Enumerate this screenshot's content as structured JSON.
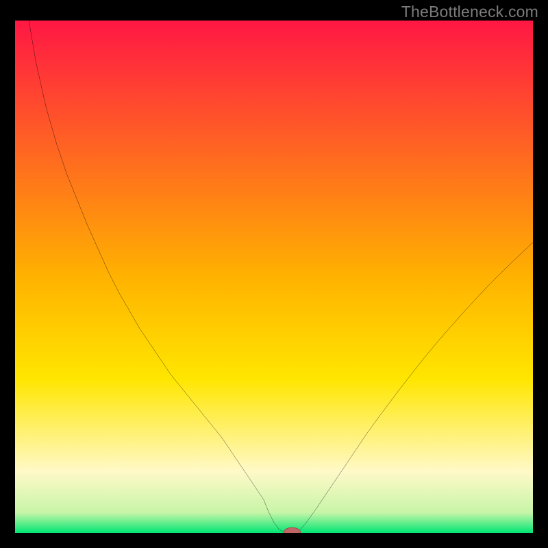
{
  "watermark": "TheBottleneck.com",
  "colors": {
    "frame": "#000000",
    "watermark": "#7c7c7c",
    "curve": "#000000",
    "marker_fill": "#c06666",
    "marker_stroke": "#a04848",
    "gradient_top": "#ff1744",
    "gradient_yellow": "#ffe600",
    "gradient_cream": "#fff9c8",
    "gradient_green": "#00e673"
  },
  "chart_data": {
    "type": "line",
    "title": "",
    "xlabel": "",
    "ylabel": "",
    "xlim": [
      0,
      100
    ],
    "ylim": [
      0,
      100
    ],
    "grid": false,
    "legend": false,
    "x": [
      0,
      2,
      4,
      6,
      8,
      10,
      12,
      14,
      16,
      18,
      20,
      22,
      24,
      26,
      28,
      30,
      32,
      34,
      36,
      38,
      40,
      42,
      44,
      46,
      48,
      49,
      50,
      51,
      52,
      53,
      54,
      55,
      56,
      58,
      60,
      62,
      64,
      66,
      68,
      70,
      72,
      74,
      76,
      78,
      80,
      82,
      84,
      86,
      88,
      90,
      92,
      94,
      96,
      98,
      100
    ],
    "values": [
      120,
      104,
      92,
      83,
      76,
      70,
      65,
      60,
      55.5,
      51,
      47,
      43.5,
      40,
      37,
      34,
      31,
      28.5,
      26,
      23.5,
      21,
      18.5,
      15.5,
      12.5,
      9.5,
      6.5,
      4.0,
      2.0,
      0.7,
      0.1,
      0.1,
      0.1,
      0.6,
      1.7,
      4.5,
      7.5,
      10.5,
      13.5,
      16.5,
      19.5,
      22.3,
      25.0,
      27.7,
      30.3,
      32.9,
      35.4,
      37.8,
      40.1,
      42.4,
      44.6,
      46.8,
      48.9,
      50.9,
      52.9,
      54.8,
      56.7
    ],
    "marker": {
      "x": 53.5,
      "y": 0.15,
      "rx": 1.6,
      "ry": 0.9
    },
    "annotations": []
  }
}
